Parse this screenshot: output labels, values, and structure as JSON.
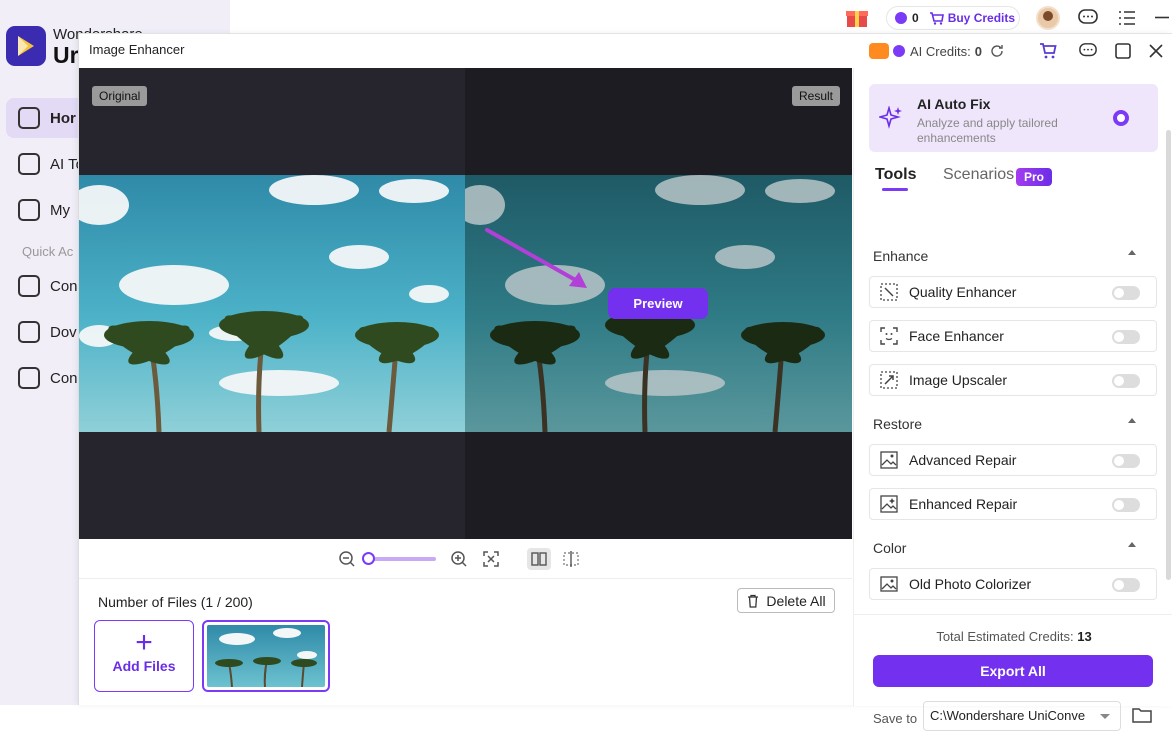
{
  "background_app": {
    "brand_line1": "Wondershare",
    "brand_line2": "Ur",
    "nav": [
      {
        "label": "Hor",
        "icon": "home-icon"
      },
      {
        "label": "AI To",
        "icon": "ai-tools-icon"
      },
      {
        "label": "My",
        "icon": "my-files-icon"
      },
      {
        "label": "Con",
        "icon": "converter-icon"
      },
      {
        "label": "Dov",
        "icon": "downloader-icon"
      },
      {
        "label": "Con",
        "icon": "compressor-icon"
      }
    ],
    "quick_access_label": "Quick Ac",
    "topbar": {
      "credit_count": "0",
      "buy_credits_label": "Buy Credits",
      "icons": [
        "gift-icon",
        "coin-icon",
        "cart-icon",
        "avatar",
        "chat-icon",
        "menu-icon",
        "minimize-icon"
      ]
    }
  },
  "modal": {
    "title": "Image Enhancer",
    "ai_credits_label": "AI Credits:",
    "ai_credits_value": "0",
    "header_icons": [
      "credit-badge-icon",
      "refresh-icon",
      "cart-icon",
      "chat-icon",
      "maximize-icon",
      "close-icon"
    ]
  },
  "preview": {
    "original_label": "Original",
    "result_label": "Result",
    "preview_button": "Preview"
  },
  "zoombar": {
    "icons": [
      "zoom-out-icon",
      "zoom-in-icon",
      "fit-screen-icon",
      "side-by-side-view-icon",
      "split-view-icon"
    ],
    "zoom_level": 0.0
  },
  "files": {
    "title": "Number of Files (1 / 200)",
    "delete_all": "Delete All",
    "add_files": "Add Files"
  },
  "panel": {
    "autofix_title": "AI Auto Fix",
    "autofix_desc": "Analyze and apply tailored enhancements",
    "tabs": {
      "tools": "Tools",
      "scenarios": "Scenarios",
      "pro_badge": "Pro"
    },
    "sections": {
      "enhance": "Enhance",
      "restore": "Restore",
      "color": "Color"
    },
    "tools": {
      "quality_enhancer": "Quality Enhancer",
      "face_enhancer": "Face Enhancer",
      "image_upscaler": "Image Upscaler",
      "advanced_repair": "Advanced Repair",
      "enhanced_repair": "Enhanced Repair",
      "old_photo_colorizer": "Old Photo Colorizer"
    },
    "total_credits_label": "Total Estimated Credits:",
    "total_credits_value": "13",
    "export_all": "Export All",
    "save_to_label": "Save to",
    "save_path": "C:\\Wondershare UniConve"
  },
  "colors": {
    "accent": "#7330ee",
    "accent_light": "#efe6fb"
  }
}
